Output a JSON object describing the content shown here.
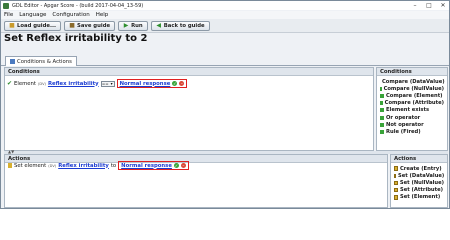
{
  "window": {
    "title": "GDL Editor - Apgar Score - (build 2017-04-04_13-59)",
    "controls": [
      "–",
      "□",
      "✕"
    ]
  },
  "menu": [
    "File",
    "Language",
    "Configuration",
    "Help"
  ],
  "toolbar": {
    "load": "Load guide...",
    "save": "Save guide",
    "run": "Run",
    "back": "Back to guide"
  },
  "page_title": "Set Reflex irritability to 2",
  "tab": {
    "label": "Conditions & Actions"
  },
  "conditions": {
    "header": "Conditions",
    "row": {
      "prefix": "Element",
      "tag": "(DV)",
      "element": "Reflex irritability",
      "operator": "==",
      "value": "Normal response"
    }
  },
  "conditions_side": {
    "header": "Conditions",
    "items": [
      "Compare (DataValue)",
      "Compare (NullValue)",
      "Compare (Element)",
      "Compare (Attribute)",
      "Element exists",
      "Or operator",
      "Not operator",
      "Rule (Fired)"
    ]
  },
  "actions": {
    "header": "Actions",
    "row": {
      "prefix": "Set element",
      "tag": "(DV)",
      "element": "Reflex irritability",
      "to": "to",
      "value": "Normal response"
    }
  },
  "actions_side": {
    "header": "Actions",
    "items": [
      "Create (Entry)",
      "Set (DataValue)",
      "Set (NullValue)",
      "Set (Attribute)",
      "Set (Element)"
    ]
  },
  "colors": {
    "highlight": "#e02020",
    "link": "#1a3bd1",
    "ok": "#3aa63a",
    "remove": "#d94a3a"
  }
}
